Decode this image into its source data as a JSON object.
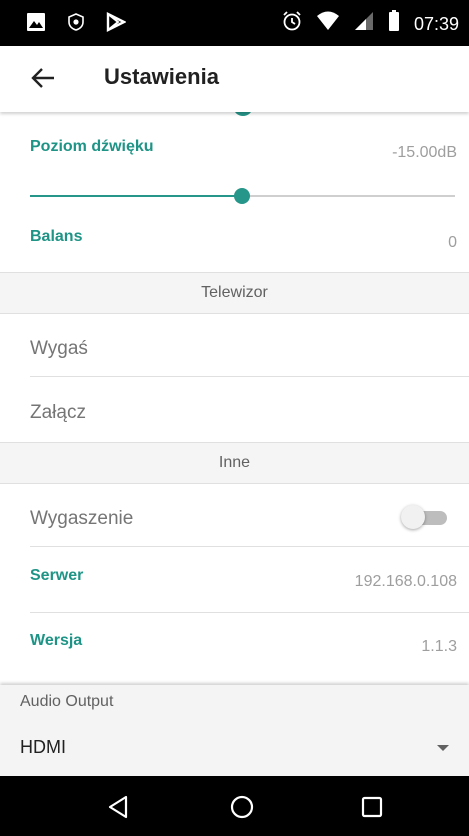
{
  "status_bar": {
    "time": "07:39",
    "left_icons": [
      "image-icon",
      "shield-icon",
      "play-store-icon"
    ],
    "right_icons": [
      "alarm-icon",
      "wifi-icon",
      "signal-icon",
      "battery-icon"
    ]
  },
  "app_bar": {
    "title": "Ustawienia",
    "back_icon": "arrow-left-icon"
  },
  "settings": {
    "volume": {
      "title": "Poziom dźwięku",
      "value": "-15.00dB",
      "slider_fraction": 0.498
    },
    "balance": {
      "title": "Balans",
      "value": "0"
    },
    "tv_category": "Telewizor",
    "tv_off": "Wygaś",
    "tv_on": "Załącz",
    "other_category": "Inne",
    "dimming": {
      "title": "Wygaszenie",
      "enabled": false
    },
    "server": {
      "title": "Serwer",
      "value": "192.168.0.108"
    },
    "version": {
      "title": "Wersja",
      "value": "1.1.3"
    }
  },
  "audio_output": {
    "label": "Audio Output",
    "selected": "HDMI"
  },
  "nav_bar": {
    "icons": [
      "back-triangle-icon",
      "home-circle-icon",
      "recents-square-icon"
    ]
  },
  "colors": {
    "accent": "#26968a",
    "accent_text": "#1e9486",
    "status_bar": "#000000",
    "secondary_text": "#9e9e9e"
  }
}
